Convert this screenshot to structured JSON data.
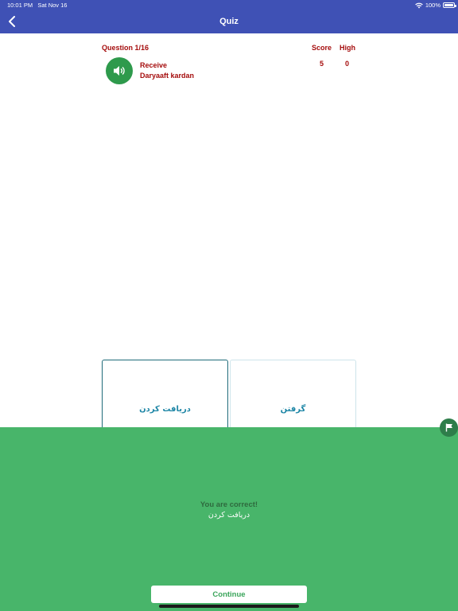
{
  "status_bar": {
    "time": "10:01 PM",
    "date": "Sat Nov 16",
    "battery": "100%",
    "wifi_icon": "wifi-icon",
    "battery_icon": "battery-icon"
  },
  "nav": {
    "title": "Quiz",
    "back_icon": "chevron-left-icon"
  },
  "question": {
    "counter": "Question 1/16",
    "score_label": "Score",
    "high_label": "High",
    "score_value": "5",
    "high_value": "0",
    "speaker_icon": "speaker-icon",
    "word": "Receive",
    "transliteration": "Daryaaft kardan"
  },
  "answers": [
    {
      "text": "دریافت کردن",
      "selected": true
    },
    {
      "text": "گرفتن",
      "selected": false
    }
  ],
  "feedback": {
    "message": "You are correct!",
    "answer": "دریافت کردن",
    "continue_label": "Continue",
    "flag_icon": "flag-icon"
  },
  "colors": {
    "nav_bar": "#3f51b5",
    "accent_red": "#a50d0d",
    "speaker_green": "#2e9a4c",
    "feedback_green": "#48b56a",
    "answer_text": "#1e86a6"
  }
}
